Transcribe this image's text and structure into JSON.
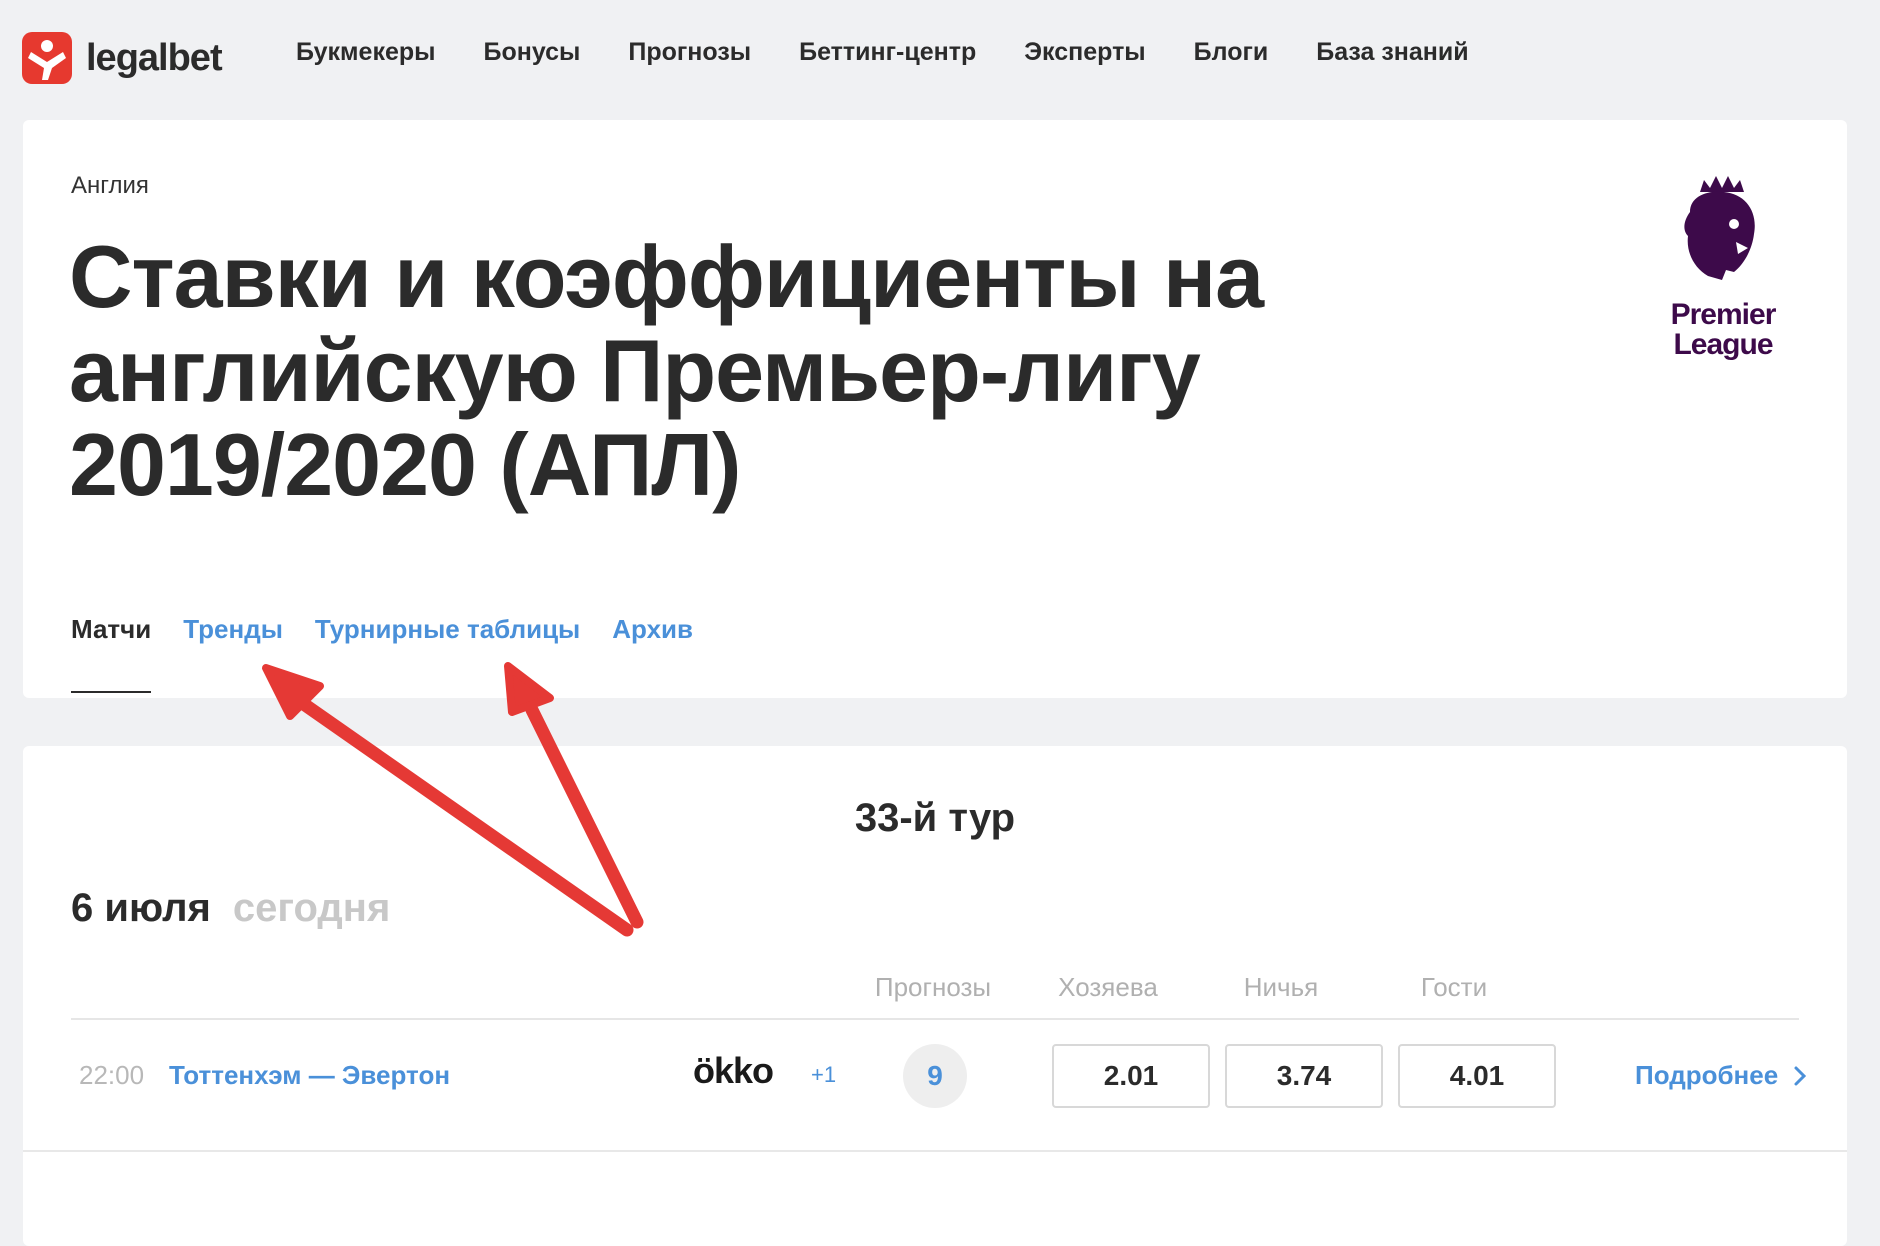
{
  "header": {
    "logo_text": "legalbet",
    "nav": [
      "Букмекеры",
      "Бонусы",
      "Прогнозы",
      "Беттинг-центр",
      "Эксперты",
      "Блоги",
      "База знаний"
    ]
  },
  "league": {
    "breadcrumb": "Англия",
    "title": "Ставки и коэффициенты на английскую Премьер-лигу 2019/2020 (АПЛ)",
    "logo_text_line1": "Premier",
    "logo_text_line2": "League",
    "logo_color": "#3d0a4a",
    "tabs": [
      {
        "label": "Матчи",
        "active": true
      },
      {
        "label": "Тренды",
        "active": false
      },
      {
        "label": "Турнирные таблицы",
        "active": false
      },
      {
        "label": "Архив",
        "active": false
      }
    ]
  },
  "matches": {
    "round": "33-й тур",
    "date": "6 июля",
    "date_note": "сегодня",
    "columns": {
      "forecasts": "Прогнозы",
      "home": "Хозяева",
      "draw": "Ничья",
      "away": "Гости"
    },
    "rows": [
      {
        "time": "22:00",
        "teams": "Тоттенхэм — Эвертон",
        "broadcaster": "ökko",
        "extra": "+1",
        "forecast_count": "9",
        "odds_home": "2.01",
        "odds_draw": "3.74",
        "odds_away": "4.01",
        "more": "Подробнее"
      }
    ]
  },
  "colors": {
    "brand": "#e6392f",
    "link": "#4a90d9",
    "annotation_arrow": "#e53935"
  }
}
